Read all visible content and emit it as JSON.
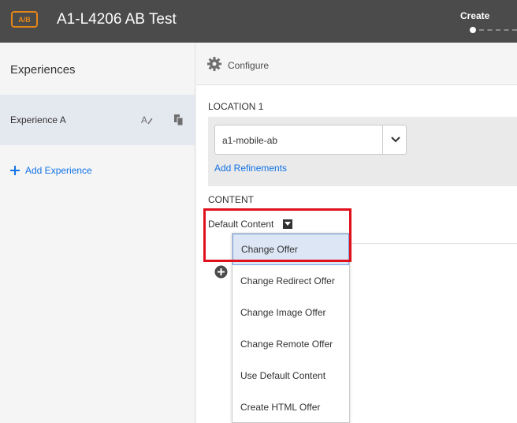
{
  "header": {
    "badge": "A/B",
    "title": "A1-L4206 AB Test",
    "step_label": "Create"
  },
  "sidebar": {
    "title": "Experiences",
    "experiences": [
      {
        "label": "Experience A"
      }
    ],
    "add_label": "Add Experience"
  },
  "main": {
    "config_label": "Configure",
    "location": {
      "title": "LOCATION 1",
      "selected": "a1-mobile-ab",
      "add_refinements": "Add Refinements"
    },
    "content": {
      "title": "CONTENT",
      "default_label": "Default Content"
    },
    "menu": [
      {
        "label": "Change Offer"
      },
      {
        "label": "Change Redirect Offer"
      },
      {
        "label": "Change Image Offer"
      },
      {
        "label": "Change Remote Offer"
      },
      {
        "label": "Use Default Content"
      },
      {
        "label": "Create HTML Offer"
      }
    ]
  },
  "colors": {
    "header_bg": "#4b4b4b",
    "badge_accent": "#e68619",
    "link_blue": "#1473e6",
    "highlight_red": "#e0101c",
    "selected_item_bg": "#dde6f5"
  },
  "icons": [
    "ab-test-icon",
    "rename-icon",
    "copy-icon",
    "plus-icon",
    "gear-icon",
    "chevron-down-icon",
    "caret-down-icon",
    "add-circle-icon"
  ]
}
